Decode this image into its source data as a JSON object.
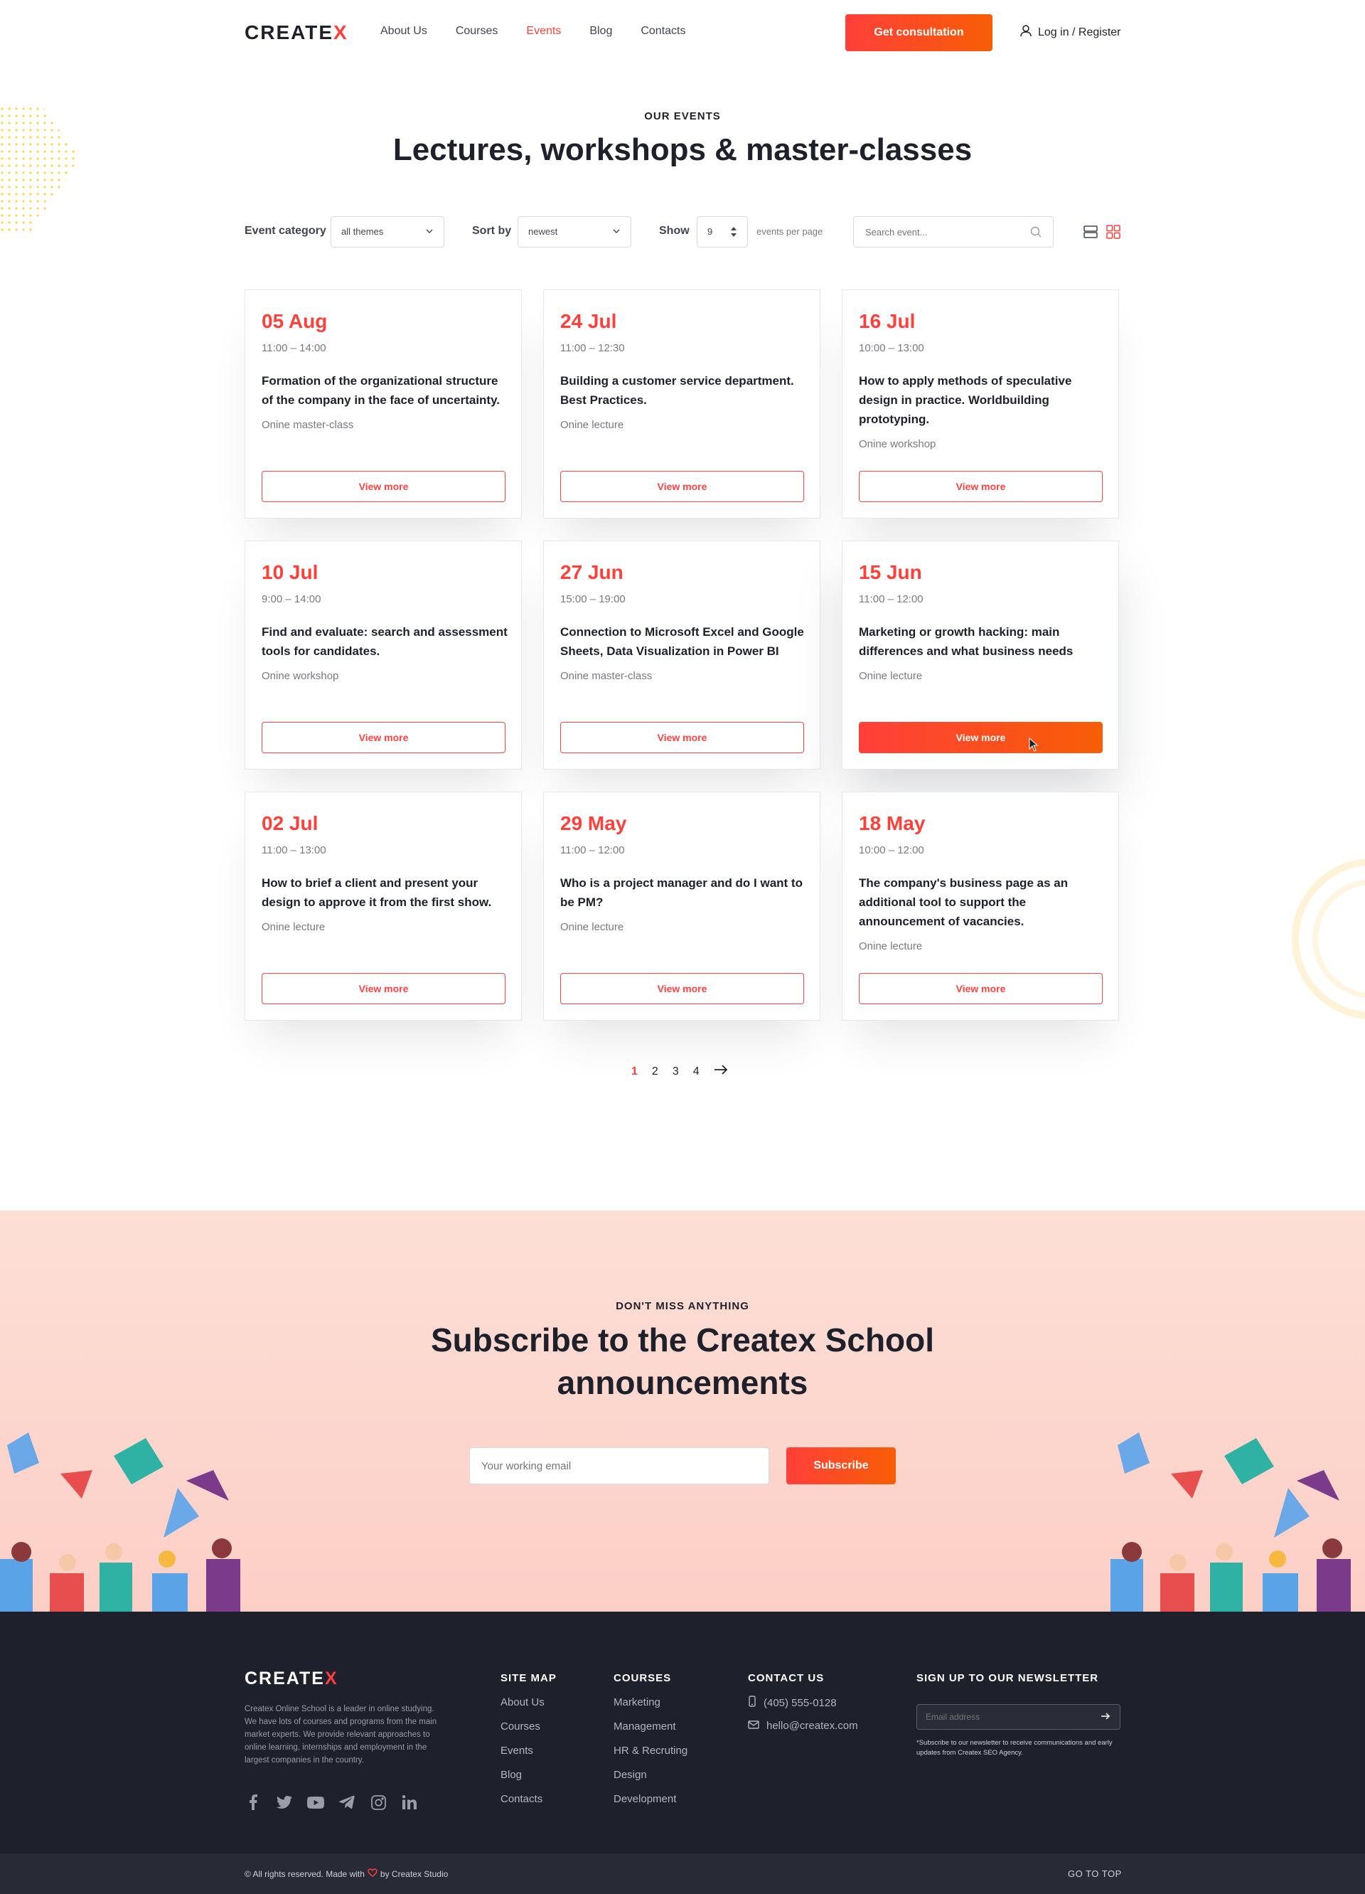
{
  "header": {
    "logo_text": "CREATE",
    "logo_x": "X",
    "nav": [
      {
        "label": "About Us",
        "active": false
      },
      {
        "label": "Courses",
        "active": false
      },
      {
        "label": "Events",
        "active": true
      },
      {
        "label": "Blog",
        "active": false
      },
      {
        "label": "Contacts",
        "active": false
      }
    ],
    "cta": "Get consultation",
    "login": "Log in / Register",
    "login_icon": "user-icon"
  },
  "hero": {
    "eyebrow": "OUR EVENTS",
    "title": "Lectures, workshops & master-classes"
  },
  "filters": {
    "category_label": "Event category",
    "category_value": "all themes",
    "sort_label": "Sort by",
    "sort_value": "newest",
    "show_label": "Show",
    "show_value": "9",
    "per_page_label": "events per page",
    "search_placeholder": "Search event..."
  },
  "events": [
    {
      "date": "05 Aug",
      "time": "11:00 – 14:00",
      "title": "Formation of the organizational structure of the company in the face of uncertainty.",
      "type": "Onine master-class",
      "button": "View more",
      "active": false
    },
    {
      "date": "24 Jul",
      "time": "11:00 – 12:30",
      "title": "Building a customer service department. Best Practices.",
      "type": "Onine lecture",
      "button": "View more",
      "active": false
    },
    {
      "date": "16 Jul",
      "time": "10:00 – 13:00",
      "title": "How to apply methods of speculative design in practice. Worldbuilding prototyping.",
      "type": "Onine  workshop",
      "button": "View more",
      "active": false
    },
    {
      "date": "10 Jul",
      "time": "9:00 – 14:00",
      "title": "Find and evaluate: search and assessment tools for candidates.",
      "type": "Onine workshop",
      "button": "View more",
      "active": false
    },
    {
      "date": "27 Jun",
      "time": "15:00 – 19:00",
      "title": "Connection to Microsoft Excel and Google Sheets, Data Visualization in Power BI",
      "type": "Onine master-class",
      "button": "View more",
      "active": false
    },
    {
      "date": "15 Jun",
      "time": "11:00 – 12:00",
      "title": "Marketing or growth hacking: main differences and what business needs",
      "type": "Onine  lecture",
      "button": "View more",
      "active": true
    },
    {
      "date": "02 Jul",
      "time": "11:00 – 13:00",
      "title": "How to brief a client and present your design to approve it from the first show.",
      "type": "Onine  lecture",
      "button": "View more",
      "active": false
    },
    {
      "date": "29 May",
      "time": "11:00 – 12:00",
      "title": "Who is a project manager and do I want to be PM?",
      "type": "Onine lecture",
      "button": "View more",
      "active": false
    },
    {
      "date": "18 May",
      "time": "10:00 – 12:00",
      "title": "The company's business page as an additional tool to support the announcement of vacancies.",
      "type": "Onine lecture",
      "button": "View more",
      "active": false
    }
  ],
  "pagination": {
    "pages": [
      "1",
      "2",
      "3",
      "4"
    ],
    "current": "1",
    "next_icon": "arrow-right-icon"
  },
  "subscribe": {
    "eyebrow": "DON'T MISS ANYTHING",
    "title": "Subscribe to the Createx School announcements",
    "placeholder": "Your working email",
    "button": "Subscribe"
  },
  "footer": {
    "logo_text": "CREATE",
    "logo_x": "X",
    "description": "Createx Online School is a leader in online studying. We have lots of courses and programs from the main market experts. We provide relevant approaches to online learning, internships and employment in the largest companies in the country.",
    "socials": [
      "facebook-icon",
      "twitter-icon",
      "youtube-icon",
      "telegram-icon",
      "instagram-icon",
      "linkedin-icon"
    ],
    "sitemap_title": "SITE MAP",
    "sitemap": [
      "About Us",
      "Courses",
      "Events",
      "Blog",
      "Contacts"
    ],
    "courses_title": "COURSES",
    "courses": [
      "Marketing",
      "Management",
      "HR & Recruting",
      "Design",
      "Development"
    ],
    "contact_title": "CONTACT US",
    "phone": "(405) 555-0128",
    "email": "hello@createx.com",
    "newsletter_title": "SIGN UP TO OUR NEWSLETTER",
    "newsletter_placeholder": "Email address",
    "newsletter_note": "*Subscribe to our newsletter to receive communications and early updates from Createx SEO Agency."
  },
  "bottom": {
    "copyright_pre": "© All rights reserved. Made with",
    "copyright_post": "by Createx Studio",
    "go_top": "GO TO TOP"
  },
  "colors": {
    "accent": "#ff3f3a",
    "accent_end": "#f75e05",
    "dark": "#1e212c",
    "subscribe_bg": "#fddfd6"
  }
}
